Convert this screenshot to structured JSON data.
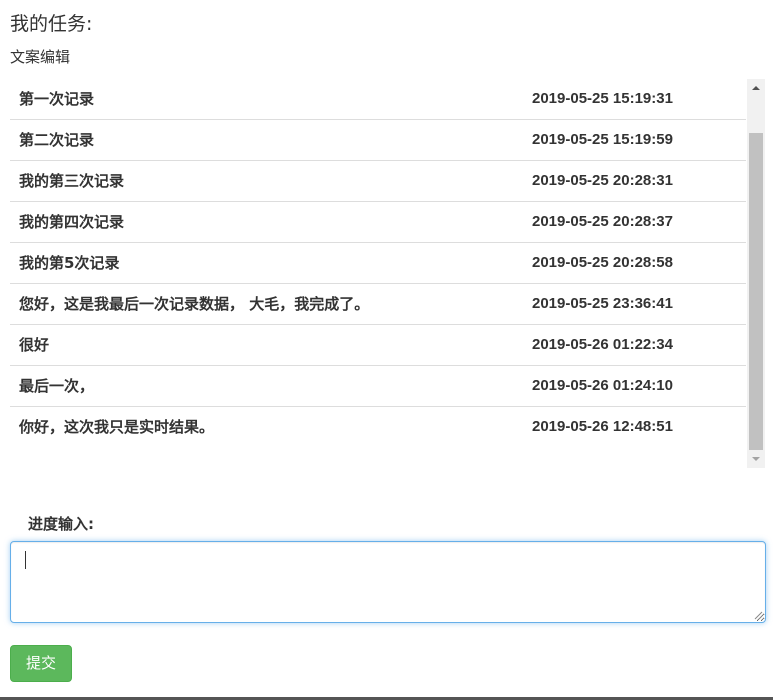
{
  "header": {
    "title": "我的任务:",
    "task_name": "文案编辑"
  },
  "records": [
    {
      "text": "第一次记录",
      "time": "2019-05-25 15:19:31"
    },
    {
      "text": "第二次记录",
      "time": "2019-05-25 15:19:59"
    },
    {
      "text": "我的第三次记录",
      "time": "2019-05-25 20:28:31"
    },
    {
      "text": "我的第四次记录",
      "time": "2019-05-25 20:28:37"
    },
    {
      "text": "我的第5次记录",
      "time": "2019-05-25 20:28:58"
    },
    {
      "text": "您好，这是我最后一次记录数据， 大毛，我完成了。",
      "time": "2019-05-25 23:36:41"
    },
    {
      "text": "很好",
      "time": "2019-05-26 01:22:34"
    },
    {
      "text": "最后一次，",
      "time": "2019-05-26 01:24:10"
    },
    {
      "text": "你好，这次我只是实时结果。",
      "time": "2019-05-26 12:48:51"
    }
  ],
  "form": {
    "progress_label": "进度输入:",
    "progress_value": "",
    "submit_label": "提交"
  },
  "colors": {
    "submit_bg": "#5cb85c",
    "input_focus_border": "#66afe9",
    "row_divider": "#dddddd",
    "scroll_thumb": "#c1c1c1"
  }
}
